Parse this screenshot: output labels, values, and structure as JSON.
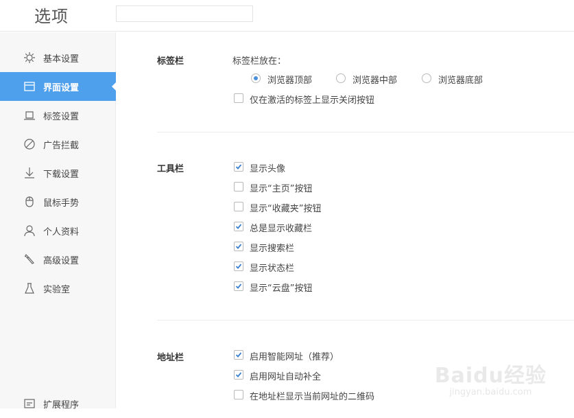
{
  "header": {
    "title": "选项",
    "search_value": ""
  },
  "sidebar": {
    "items": [
      {
        "label": "基本设置",
        "icon": "gear-icon",
        "active": false
      },
      {
        "label": "界面设置",
        "icon": "window-icon",
        "active": true
      },
      {
        "label": "标签设置",
        "icon": "tab-icon",
        "active": false
      },
      {
        "label": "广告拦截",
        "icon": "block-icon",
        "active": false
      },
      {
        "label": "下载设置",
        "icon": "download-icon",
        "active": false
      },
      {
        "label": "鼠标手势",
        "icon": "mouse-icon",
        "active": false
      },
      {
        "label": "个人资料",
        "icon": "user-icon",
        "active": false
      },
      {
        "label": "高级设置",
        "icon": "wrench-icon",
        "active": false
      },
      {
        "label": "实验室",
        "icon": "flask-icon",
        "active": false
      }
    ],
    "bottom_item": {
      "label": "扩展程序",
      "icon": "extension-icon"
    }
  },
  "sections": {
    "tabbar": {
      "title": "标签栏",
      "position_label": "标签栏放在：",
      "radios": [
        {
          "label": "浏览器顶部",
          "checked": true
        },
        {
          "label": "浏览器中部",
          "checked": false
        },
        {
          "label": "浏览器底部",
          "checked": false
        }
      ],
      "checkbox": {
        "label": "仅在激活的标签上显示关闭按钮",
        "checked": false
      }
    },
    "toolbar": {
      "title": "工具栏",
      "checkboxes": [
        {
          "label": "显示头像",
          "checked": true
        },
        {
          "label": "显示“主页”按钮",
          "checked": false
        },
        {
          "label": "显示“收藏夹”按钮",
          "checked": false
        },
        {
          "label": "总是显示收藏栏",
          "checked": true
        },
        {
          "label": "显示搜索栏",
          "checked": true
        },
        {
          "label": "显示状态栏",
          "checked": true
        },
        {
          "label": "显示“云盘”按钮",
          "checked": true
        }
      ]
    },
    "addressbar": {
      "title": "地址栏",
      "checkboxes": [
        {
          "label": "启用智能网址（推荐）",
          "checked": true
        },
        {
          "label": "启用网址自动补全",
          "checked": true
        },
        {
          "label": "在地址栏显示当前网址的二维码",
          "checked": false
        }
      ]
    }
  },
  "watermark": {
    "main": "Baidu经验",
    "sub": "jingyan.baidu.com"
  },
  "colors": {
    "accent": "#4fa0ec",
    "check": "#3b7fd1"
  }
}
